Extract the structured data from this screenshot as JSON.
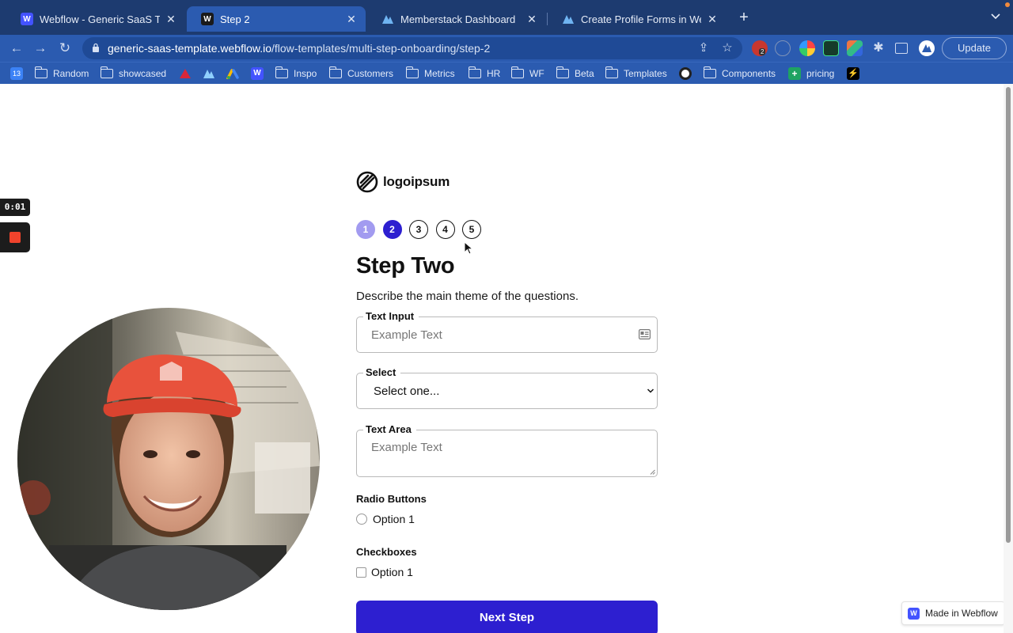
{
  "browser": {
    "tabs": [
      {
        "title": "Webflow - Generic SaaS Templ",
        "favicon": "webflow-icon",
        "active": false
      },
      {
        "title": "Step 2",
        "favicon": "webflow-icon",
        "active": true
      },
      {
        "title": "Memberstack Dashboard",
        "favicon": "memberstack-icon",
        "active": false
      },
      {
        "title": "Create Profile Forms in Webflo",
        "favicon": "memberstack-icon",
        "active": false
      }
    ],
    "url_host": "generic-saas-template.webflow.io",
    "url_path": "/flow-templates/multi-step-onboarding/step-2",
    "update_label": "Update",
    "extension_badge": "2",
    "calendar_day": "13",
    "bookmarks": [
      "Random",
      "showcased",
      "Inspo",
      "Customers",
      "Metrics",
      "HR",
      "WF",
      "Beta",
      "Templates",
      "Components",
      "pricing"
    ]
  },
  "page": {
    "logo_text": "logoipsum",
    "steps": [
      {
        "label": "1",
        "state": "done"
      },
      {
        "label": "2",
        "state": "current"
      },
      {
        "label": "3",
        "state": "upcoming"
      },
      {
        "label": "4",
        "state": "upcoming"
      },
      {
        "label": "5",
        "state": "upcoming"
      }
    ],
    "heading": "Step Two",
    "description": "Describe the main theme of the questions.",
    "text_input": {
      "label": "Text Input",
      "placeholder": "Example Text"
    },
    "select": {
      "label": "Select",
      "value": "Select one..."
    },
    "text_area": {
      "label": "Text Area",
      "placeholder": "Example Text"
    },
    "radio": {
      "label": "Radio Buttons",
      "option": "Option 1"
    },
    "checkbox": {
      "label": "Checkboxes",
      "option": "Option 1"
    },
    "next_button": "Next Step",
    "badge": "Made in Webflow"
  },
  "recording": {
    "timer": "0:01"
  },
  "colors": {
    "primary": "#2d1fd0",
    "step_done": "#a29bf0",
    "chrome_dark": "#1d3b70",
    "chrome": "#2b5bb0",
    "stop": "#f0432c"
  }
}
